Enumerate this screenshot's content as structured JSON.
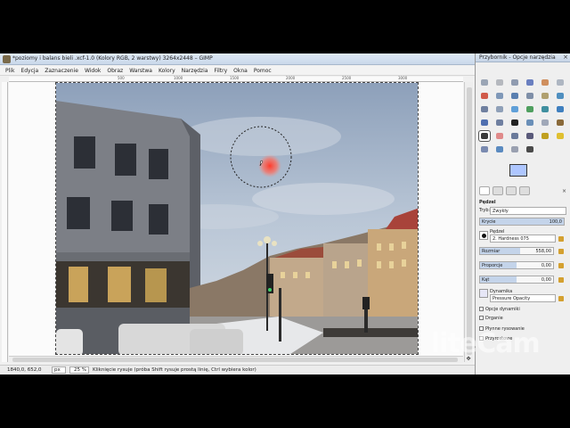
{
  "window": {
    "title": "*poziomy i balans bieli .xcf-1.0 (Kolory RGB, 2 warstwy) 3264x2448 – GIMP"
  },
  "menu": [
    "Plik",
    "Edycja",
    "Zaznaczenie",
    "Widok",
    "Obraz",
    "Warstwa",
    "Kolory",
    "Narzędzia",
    "Filtry",
    "Okna",
    "Pomoc"
  ],
  "ruler": {
    "top_ticks": [
      "500",
      "1000",
      "1500",
      "2000",
      "2500",
      "3000"
    ]
  },
  "statusbar": {
    "coords": "1840,0, 652,0",
    "unit": "px",
    "zoom": "25 %",
    "message": "Kliknięcie rysuje (próba Shift rysuje prostą linię, Ctrl wybiera kolor)"
  },
  "toolbox": {
    "title": "Przybornik - Opcje narzędzia",
    "close_glyph": "×",
    "tools": [
      {
        "icon": "rect-select-icon",
        "color": "#9aa5b5"
      },
      {
        "icon": "ellipse-select-icon",
        "color": "#b5b8be"
      },
      {
        "icon": "free-select-icon",
        "color": "#8f9bb0"
      },
      {
        "icon": "fuzzy-select-icon",
        "color": "#6a7fc0"
      },
      {
        "icon": "color-select-icon",
        "color": "#cf8f5f"
      },
      {
        "icon": "scissors-icon",
        "color": "#aeb6c2"
      },
      {
        "icon": "foreground-select-icon",
        "color": "#d05a4a"
      },
      {
        "icon": "paths-icon",
        "color": "#7f98b8"
      },
      {
        "icon": "color-picker-icon",
        "color": "#5a7fb0"
      },
      {
        "icon": "zoom-icon",
        "color": "#7f8fa8"
      },
      {
        "icon": "measure-icon",
        "color": "#b0a070"
      },
      {
        "icon": "move-icon",
        "color": "#4f8fc0"
      },
      {
        "icon": "align-icon",
        "color": "#6f7f9f"
      },
      {
        "icon": "crop-icon",
        "color": "#8fa0b8"
      },
      {
        "icon": "rotate-icon",
        "color": "#5f9fd8"
      },
      {
        "icon": "scale-icon",
        "color": "#4f9f5f"
      },
      {
        "icon": "shear-icon",
        "color": "#3f8f9f"
      },
      {
        "icon": "perspective-icon",
        "color": "#3f7fbf"
      },
      {
        "icon": "flip-icon",
        "color": "#4f6fb0"
      },
      {
        "icon": "cage-icon",
        "color": "#6f7fa0"
      },
      {
        "icon": "text-icon",
        "color": "#222222"
      },
      {
        "icon": "bucket-fill-icon",
        "color": "#6a8fb8"
      },
      {
        "icon": "blend-icon",
        "color": "#a0a8b8"
      },
      {
        "icon": "pencil-icon",
        "color": "#8a6a3a"
      },
      {
        "icon": "paintbrush-icon",
        "color": "#3a3a3a"
      },
      {
        "icon": "eraser-icon",
        "color": "#e08a8a"
      },
      {
        "icon": "airbrush-icon",
        "color": "#6a7a9a"
      },
      {
        "icon": "ink-icon",
        "color": "#5a5a7a"
      },
      {
        "icon": "clone-icon",
        "color": "#c0a020"
      },
      {
        "icon": "heal-icon",
        "color": "#e0c030"
      },
      {
        "icon": "perspective-clone-icon",
        "color": "#7a8ab0"
      },
      {
        "icon": "blur-icon",
        "color": "#5a8ac0"
      },
      {
        "icon": "smudge-icon",
        "color": "#9aa0b0"
      },
      {
        "icon": "dodge-burn-icon",
        "color": "#4a4a4a"
      }
    ],
    "active_tool_index": 24,
    "colors": {
      "foreground": "#aec6ff",
      "background": "#ffffff"
    }
  },
  "options": {
    "title": "Pędzel",
    "mode_label": "Tryb:",
    "mode_value": "Zwykły",
    "opacity_label": "Krycie",
    "opacity_value": "100,0",
    "opacity_fraction": 1.0,
    "brush_label": "Pędzel",
    "brush_value": "2. Hardness 075",
    "size_label": "Rozmiar",
    "size_value": "558,00",
    "size_fraction": 0.55,
    "ratio_label": "Proporcje",
    "ratio_value": "0,00",
    "ratio_fraction": 0.5,
    "angle_label": "Kąt",
    "angle_value": "0,00",
    "angle_fraction": 0.5,
    "dynamics_label": "Dynamika",
    "dynamics_value": "Pressure Opacity",
    "dynamics_options_label": "Opcje dynamiki",
    "jitter_label": "Drganie",
    "smooth_label": "Płynne rysowanie",
    "incremental_label": "Przyrostowe"
  },
  "watermark": "liteCam"
}
